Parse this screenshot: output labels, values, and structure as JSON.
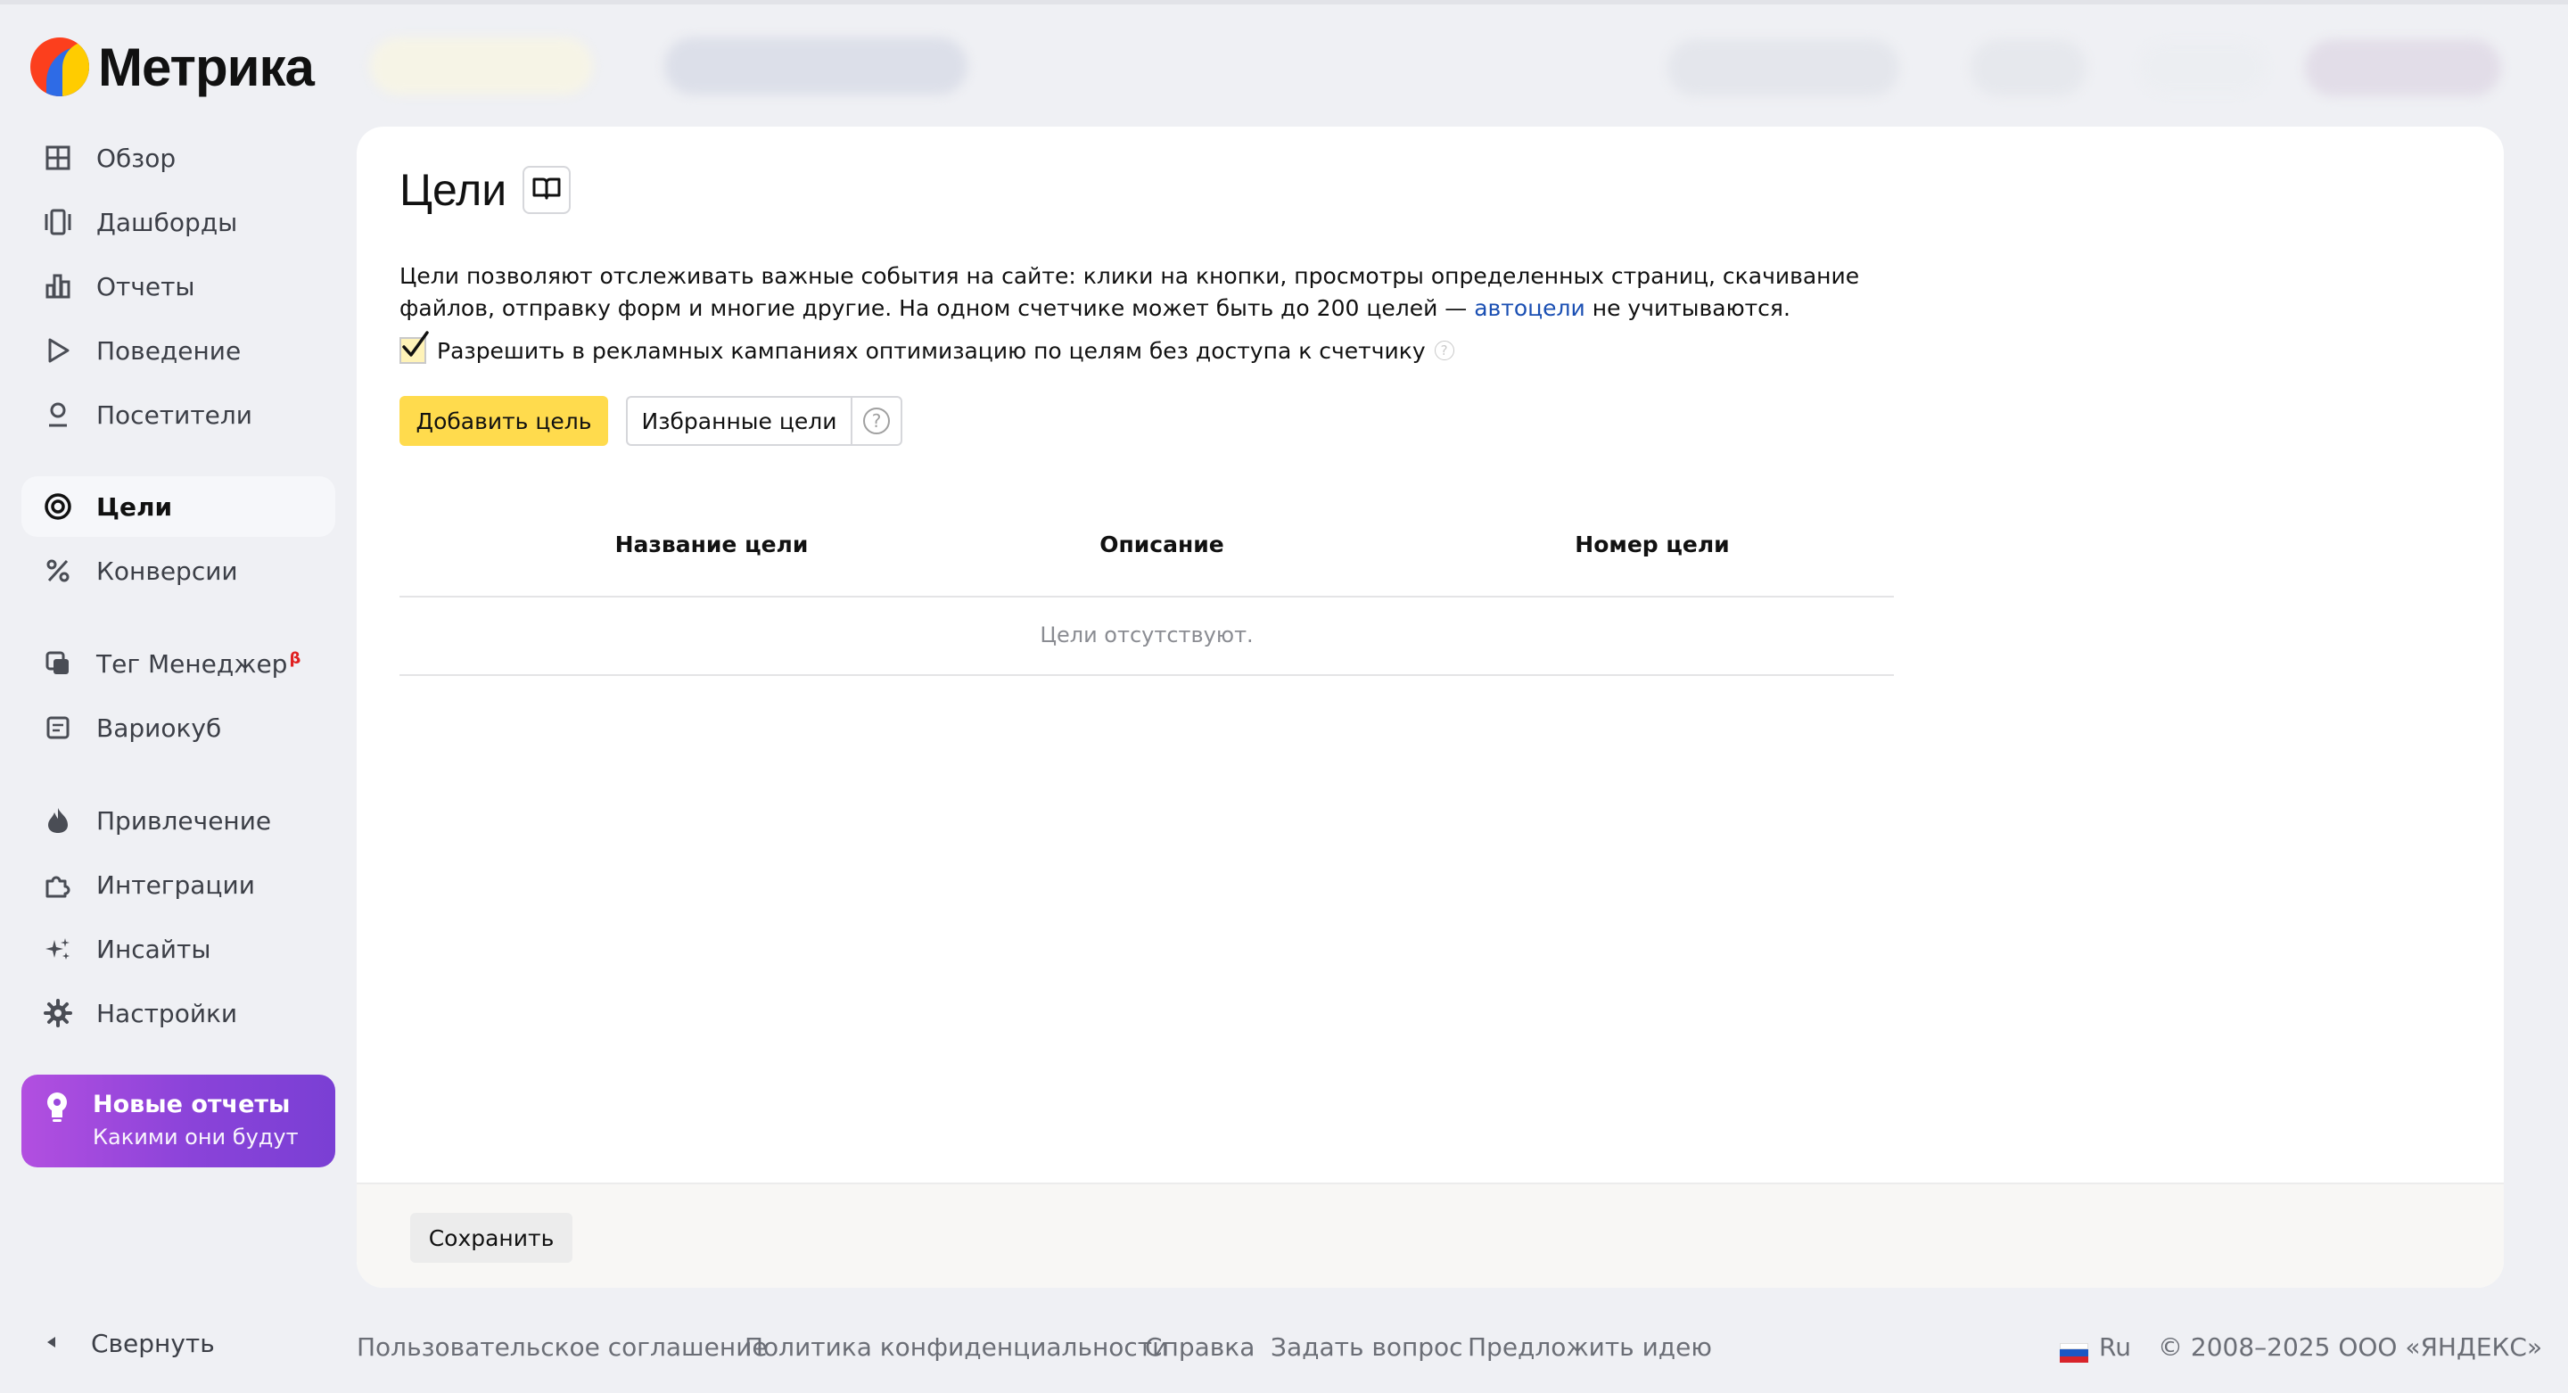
{
  "app": {
    "name": "Метрика"
  },
  "sidebar": {
    "items": [
      {
        "label": "Обзор",
        "icon": "grid-icon"
      },
      {
        "label": "Дашборды",
        "icon": "dashboards-icon"
      },
      {
        "label": "Отчеты",
        "icon": "bar-chart-icon"
      },
      {
        "label": "Поведение",
        "icon": "play-icon"
      },
      {
        "label": "Посетители",
        "icon": "user-icon"
      },
      {
        "label": "Цели",
        "icon": "target-icon",
        "active": true
      },
      {
        "label": "Конверсии",
        "icon": "percent-icon"
      },
      {
        "label": "Тег Менеджер",
        "icon": "tag-manager-icon",
        "badge": "β"
      },
      {
        "label": "Вариокуб",
        "icon": "variocube-icon"
      },
      {
        "label": "Привлечение",
        "icon": "flame-icon"
      },
      {
        "label": "Интеграции",
        "icon": "puzzle-icon"
      },
      {
        "label": "Инсайты",
        "icon": "sparkles-icon"
      },
      {
        "label": "Настройки",
        "icon": "gear-icon"
      }
    ],
    "promo": {
      "title": "Новые отчеты",
      "subtitle": "Какими они будут",
      "icon": "lightbulb-icon"
    },
    "collapse_label": "Свернуть"
  },
  "main": {
    "title": "Цели",
    "description_part1": "Цели позволяют отслеживать важные события на сайте: клики на кнопки, просмотры определенных страниц, скачивание файлов, отправку форм и многие другие. На одном счетчике может быть до 200 целей — ",
    "description_link": "автоцели",
    "description_part2": " не учитываются.",
    "checkbox_label": "Разрешить в рекламных кампаниях оптимизацию по целям без доступа к счетчику",
    "checkbox_checked": true,
    "add_goal_button": "Добавить цель",
    "favorite_goals_button": "Избранные цели",
    "table": {
      "columns": [
        "Название цели",
        "Описание",
        "Номер цели"
      ],
      "empty_text": "Цели отсутствуют."
    },
    "save_button": "Сохранить"
  },
  "footer": {
    "links": [
      "Пользовательское соглашение",
      "Политика конфиденциальности",
      "Справка",
      "Задать вопрос",
      "Предложить идею"
    ],
    "language": "Ru",
    "copyright": "© 2008–2025 ООО «ЯНДЕКС»"
  },
  "colors": {
    "accent_yellow": "#ffdb4d",
    "link_blue": "#1a4fb3",
    "promo_purple": "#8a43d9",
    "background": "#eff0f4"
  }
}
